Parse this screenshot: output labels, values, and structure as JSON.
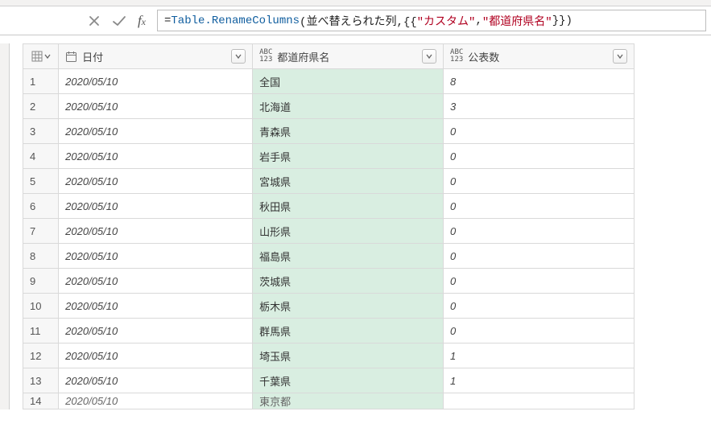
{
  "formula": {
    "eq": "= ",
    "fn": "Table.RenameColumns",
    "open": "(並べ替えられた列,{{",
    "str1": "\"カスタム\"",
    "comma": ", ",
    "str2": "\"都道府県名\"",
    "close": "}})"
  },
  "columns": {
    "date_label": "日付",
    "pref_label": "都道府県名",
    "count_label": "公表数",
    "type_abc": "ABC",
    "type_123": "123"
  },
  "rows": [
    {
      "n": "1",
      "date": "2020/05/10",
      "pref": "全国",
      "count": "8"
    },
    {
      "n": "2",
      "date": "2020/05/10",
      "pref": "北海道",
      "count": "3"
    },
    {
      "n": "3",
      "date": "2020/05/10",
      "pref": "青森県",
      "count": "0"
    },
    {
      "n": "4",
      "date": "2020/05/10",
      "pref": "岩手県",
      "count": "0"
    },
    {
      "n": "5",
      "date": "2020/05/10",
      "pref": "宮城県",
      "count": "0"
    },
    {
      "n": "6",
      "date": "2020/05/10",
      "pref": "秋田県",
      "count": "0"
    },
    {
      "n": "7",
      "date": "2020/05/10",
      "pref": "山形県",
      "count": "0"
    },
    {
      "n": "8",
      "date": "2020/05/10",
      "pref": "福島県",
      "count": "0"
    },
    {
      "n": "9",
      "date": "2020/05/10",
      "pref": "茨城県",
      "count": "0"
    },
    {
      "n": "10",
      "date": "2020/05/10",
      "pref": "栃木県",
      "count": "0"
    },
    {
      "n": "11",
      "date": "2020/05/10",
      "pref": "群馬県",
      "count": "0"
    },
    {
      "n": "12",
      "date": "2020/05/10",
      "pref": "埼玉県",
      "count": "1"
    },
    {
      "n": "13",
      "date": "2020/05/10",
      "pref": "千葉県",
      "count": "1"
    }
  ],
  "cutoff": {
    "n": "14",
    "date": "2020/05/10",
    "pref": "東京都",
    "count": ""
  }
}
